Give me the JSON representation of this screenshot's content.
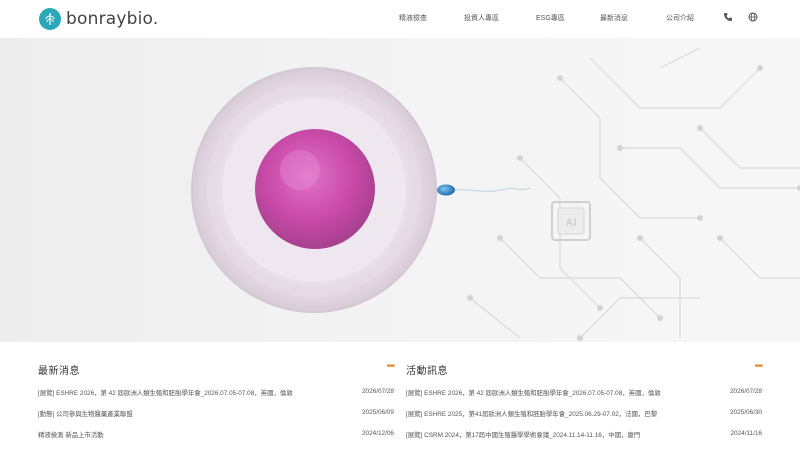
{
  "brand": {
    "name": "bonraybio.",
    "accent": "#29a8b8"
  },
  "nav": {
    "items": [
      {
        "label": "精液檢查"
      },
      {
        "label": "投資人專區"
      },
      {
        "label": "ESG專區"
      },
      {
        "label": "最新消息"
      },
      {
        "label": "公司介紹"
      }
    ],
    "icons": [
      "phone-icon",
      "globe-icon"
    ]
  },
  "hero": {
    "badge_text": "AI"
  },
  "news": {
    "title": "最新消息",
    "more_label": "•••",
    "rows": [
      {
        "title": "[展覽] ESHRE 2026，第 42 屆歐洲人類生殖和胚胎學年會_2026.07.05-07.08，英國，倫敦",
        "date": "2026/07/28"
      },
      {
        "title": "[動態] 公司參與生物醫藥產業聯盟",
        "date": "2025/06/09"
      },
      {
        "title": "精液檢測 新品上市活動",
        "date": "2024/12/06"
      }
    ]
  },
  "events": {
    "title": "活動訊息",
    "more_label": "•••",
    "rows": [
      {
        "title": "[展覽] ESHRE 2026，第 42 屆歐洲人類生殖和胚胎學年會_2026.07.05-07.08，英國，倫敦",
        "date": "2026/07/28"
      },
      {
        "title": "[展覽] ESHRE 2025，第41屆歐洲人類生殖和胚胎學年會_2025.06.29-07.02，法國，巴黎",
        "date": "2025/06/30"
      },
      {
        "title": "[展覽] CSRM 2024，第17屆中國生殖醫學學術會議_2024.11.14-11.16，中國，廈門",
        "date": "2024/11/16"
      }
    ]
  }
}
